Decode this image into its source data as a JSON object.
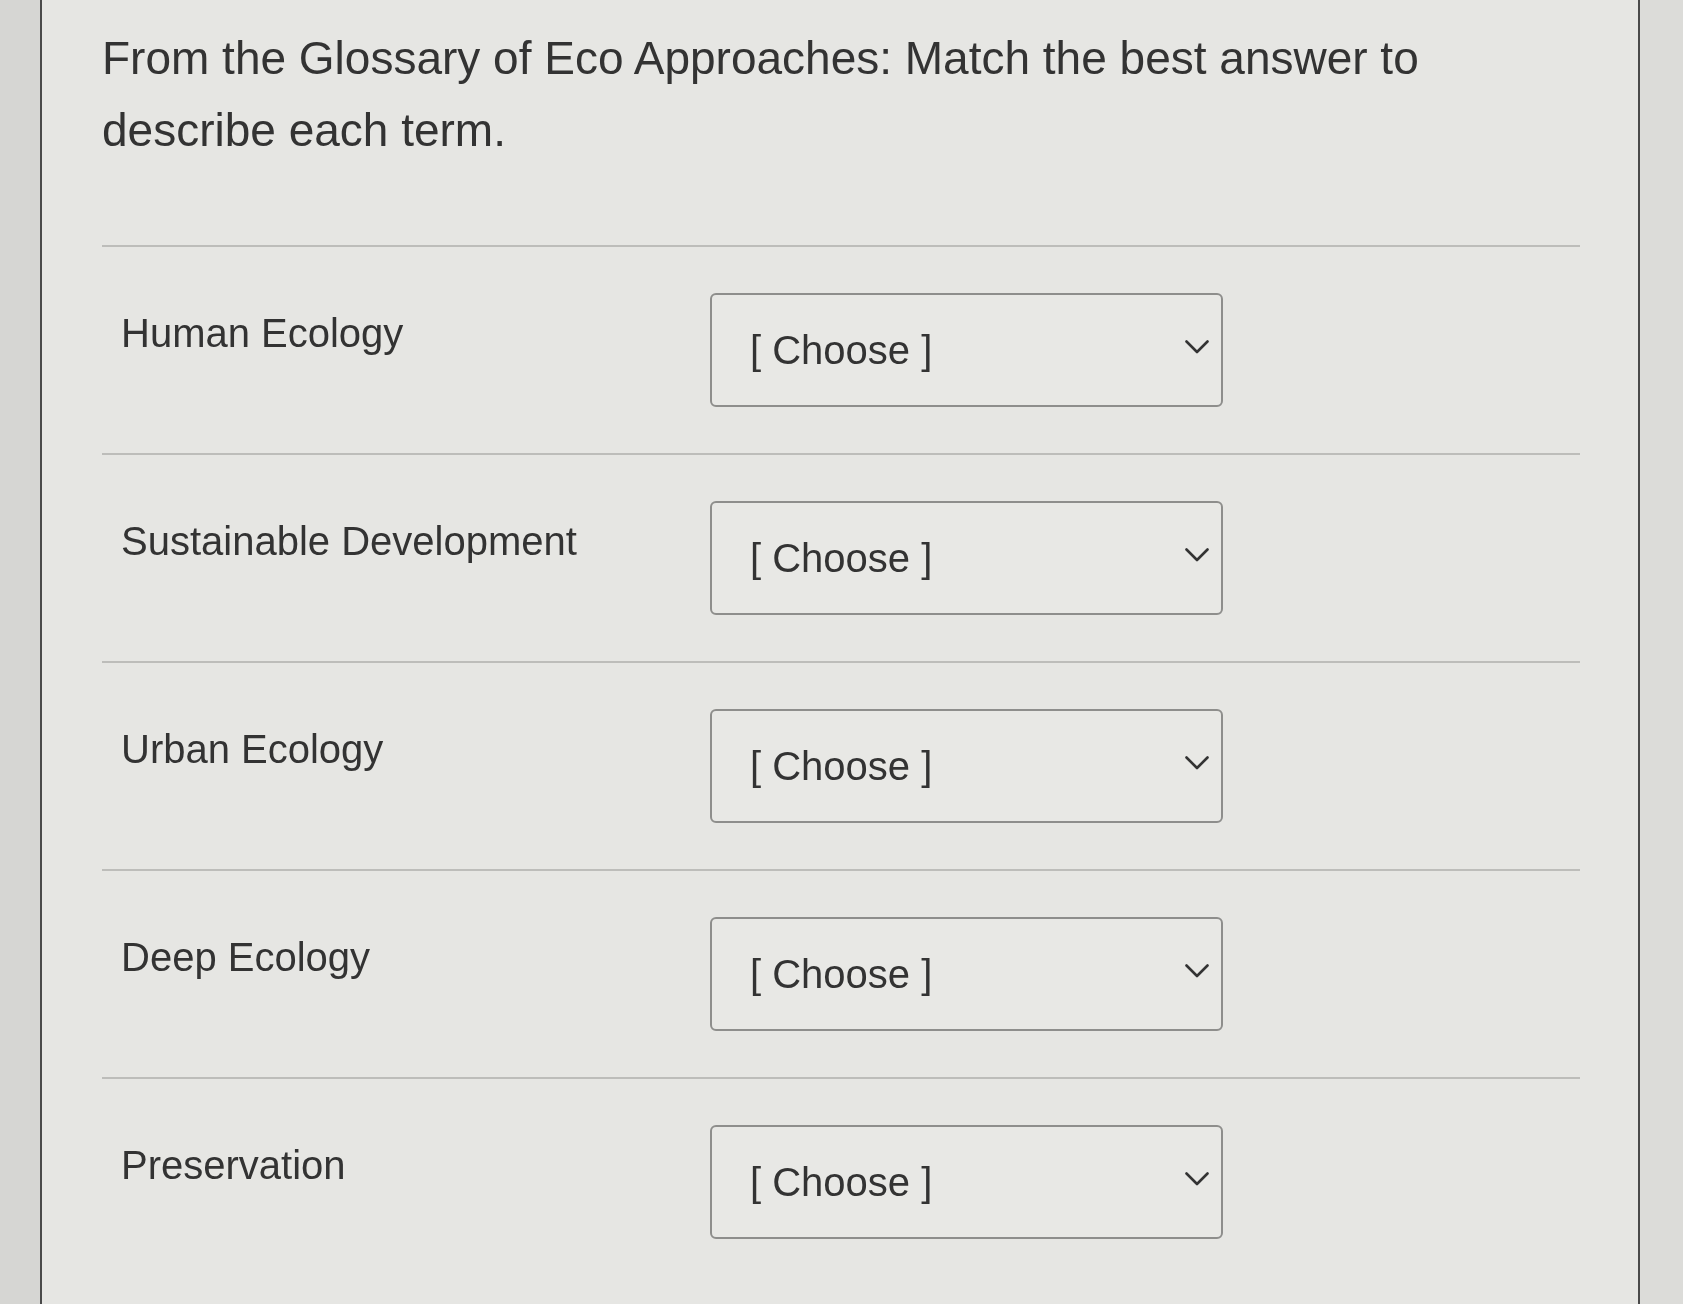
{
  "question": {
    "text": "From the Glossary of Eco Approaches: Match the best answer to describe each term."
  },
  "items": [
    {
      "term": "Human Ecology",
      "dropdown": {
        "value": "[ Choose ]"
      }
    },
    {
      "term": "Sustainable Development",
      "dropdown": {
        "value": "[ Choose ]"
      }
    },
    {
      "term": "Urban Ecology",
      "dropdown": {
        "value": "[ Choose ]"
      }
    },
    {
      "term": "Deep Ecology",
      "dropdown": {
        "value": "[ Choose ]"
      }
    },
    {
      "term": "Preservation",
      "dropdown": {
        "value": "[ Choose ]"
      }
    }
  ]
}
